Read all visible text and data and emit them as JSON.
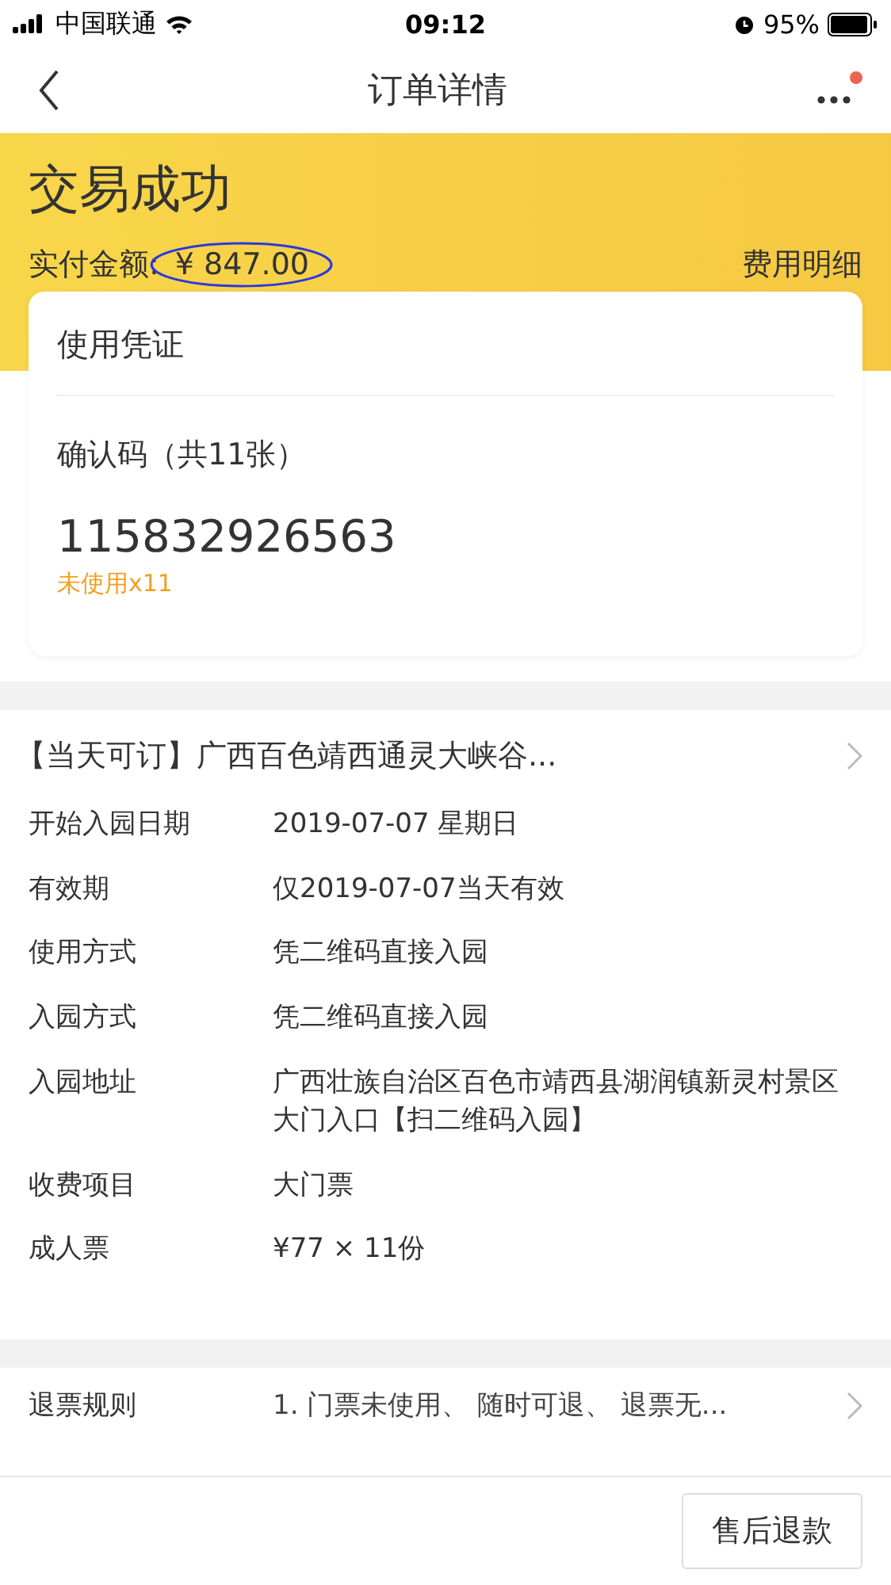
{
  "status_bar": {
    "carrier": "中国联通",
    "time": "09:12",
    "battery": "95%"
  },
  "nav": {
    "title": "订单详情",
    "has_notification": true
  },
  "header": {
    "status": "交易成功",
    "amount_label": "实付金额:",
    "amount": "¥ 847.00",
    "amount_circled": true,
    "detail_link": "费用明细"
  },
  "voucher": {
    "title": "使用凭证",
    "code_label": "确认码（共11张）",
    "code": "115832926563",
    "usage": "未使用x11"
  },
  "product": {
    "title": "【当天可订】广西百色靖西通灵大峡谷...",
    "rows": [
      {
        "label": "开始入园日期",
        "value": "2019-07-07 星期日"
      },
      {
        "label": "有效期",
        "value": "仅2019-07-07当天有效"
      },
      {
        "label": "使用方式",
        "value": "凭二维码直接入园"
      },
      {
        "label": "入园方式",
        "value": "凭二维码直接入园"
      },
      {
        "label": "入园地址",
        "value": "广西壮族自治区百色市靖西县湖润镇新灵村景区大门入口【扫二维码入园】"
      },
      {
        "label": "收费项目",
        "value": "大门票"
      },
      {
        "label": "成人票",
        "value": "¥77 × 11份"
      }
    ]
  },
  "refund_rule": {
    "label": "退票规则",
    "value": "1. 门票未使用、 随时可退、 退票无..."
  },
  "bottom_bar": {
    "button": "售后退款"
  }
}
